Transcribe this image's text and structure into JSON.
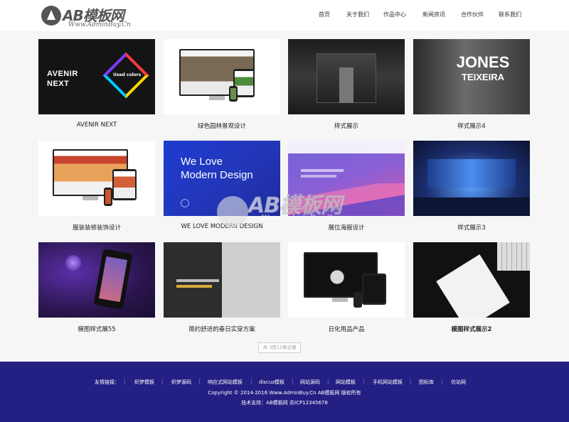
{
  "brand": {
    "logo_text": "AB模板网",
    "logo_sub": "Www.AdminBuy.Cn"
  },
  "nav": [
    "首页",
    "关于我们",
    "作品中心",
    "新闻资讯",
    "合作伙伴",
    "联系我们"
  ],
  "gallery": [
    {
      "caption": "AVENIR NEXT",
      "art_lines": [
        "AVENIR",
        "NEXT"
      ],
      "art_tag": "Used colors"
    },
    {
      "caption": "绿色园林景观设计"
    },
    {
      "caption": "样式展示"
    },
    {
      "caption": "样式展示4",
      "art_lines": [
        "JONES",
        "TEIXEIRA"
      ]
    },
    {
      "caption": "服装装修装饰设计"
    },
    {
      "caption": "WE LOVE MODERN DESIGN",
      "art_lines": [
        "We Love",
        "Modern Design"
      ]
    },
    {
      "caption": "展位海报设计"
    },
    {
      "caption": "样式展示3"
    },
    {
      "caption": "模图样式展55"
    },
    {
      "caption": "简约舒适的春日实穿方案"
    },
    {
      "caption": "日化用品产品"
    },
    {
      "caption": "模图样式展示2"
    }
  ],
  "pager": {
    "text": "共 3页12条记录"
  },
  "watermark": {
    "text": "AB模板网",
    "sub": "Www.AdminBuy.Cn"
  },
  "footer": {
    "links_label": "友情链接：",
    "links": [
      "织梦模板",
      "织梦源码",
      "响应式网站模板",
      "discuz模板",
      "网站源码",
      "网站模板",
      "手机网站模板",
      "图标库",
      "仿站网"
    ],
    "copyright": "Copyright © 2014-2016 Www.AdminBuy.Cn AB模板网 版权所有",
    "tech": "技术支持：AB模板网    苏ICP12345678"
  },
  "colors": {
    "footer_bg": "#241f83",
    "accent": "#241f83"
  }
}
